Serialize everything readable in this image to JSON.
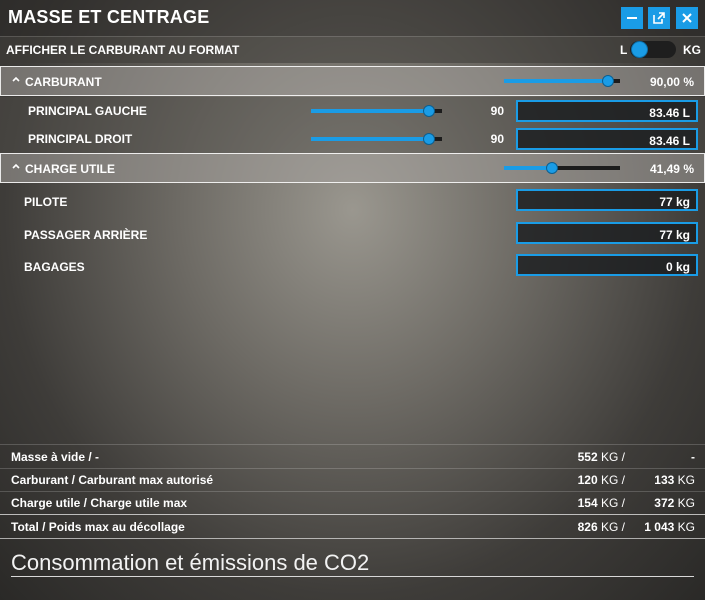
{
  "window": {
    "title": "MASSE ET CENTRAGE",
    "buttons": [
      "minimize-icon",
      "popout-icon",
      "close-icon"
    ],
    "accent_color": "#1a9ce6"
  },
  "fuel_format": {
    "label": "AFFICHER LE CARBURANT AU FORMAT",
    "option_left": "L",
    "option_right": "KG",
    "selected": "L"
  },
  "fuel_section": {
    "label": "CARBURANT",
    "percent_text": "90,00 %",
    "slider_fraction": 0.9,
    "tanks": [
      {
        "label": "PRINCIPAL GAUCHE",
        "slider_value": "90",
        "slider_fraction": 0.9,
        "field_value": "83.46 L"
      },
      {
        "label": "PRINCIPAL DROIT",
        "slider_value": "90",
        "slider_fraction": 0.9,
        "field_value": "83.46 L"
      }
    ]
  },
  "payload_section": {
    "label": "CHARGE UTILE",
    "percent_text": "41,49 %",
    "slider_fraction": 0.4149,
    "stations": [
      {
        "label": "PILOTE",
        "field_value": "77 kg"
      },
      {
        "label": "PASSAGER ARRIÈRE",
        "field_value": "77 kg"
      },
      {
        "label": "BAGAGES",
        "field_value": "0 kg"
      }
    ]
  },
  "summary": [
    {
      "label": "Masse à vide / -",
      "value": "552",
      "value_unit": "KG /",
      "max": "-",
      "max_unit": ""
    },
    {
      "label": "Carburant / Carburant max autorisé",
      "value": "120",
      "value_unit": "KG /",
      "max": "133",
      "max_unit": "KG"
    },
    {
      "label": "Charge utile / Charge utile max",
      "value": "154",
      "value_unit": "KG /",
      "max": "372",
      "max_unit": "KG"
    },
    {
      "label": "Total / Poids max au décollage",
      "value": "826",
      "value_unit": "KG /",
      "max": "1 043",
      "max_unit": "KG"
    }
  ],
  "consumption": {
    "title": "Consommation et émissions de CO2"
  }
}
